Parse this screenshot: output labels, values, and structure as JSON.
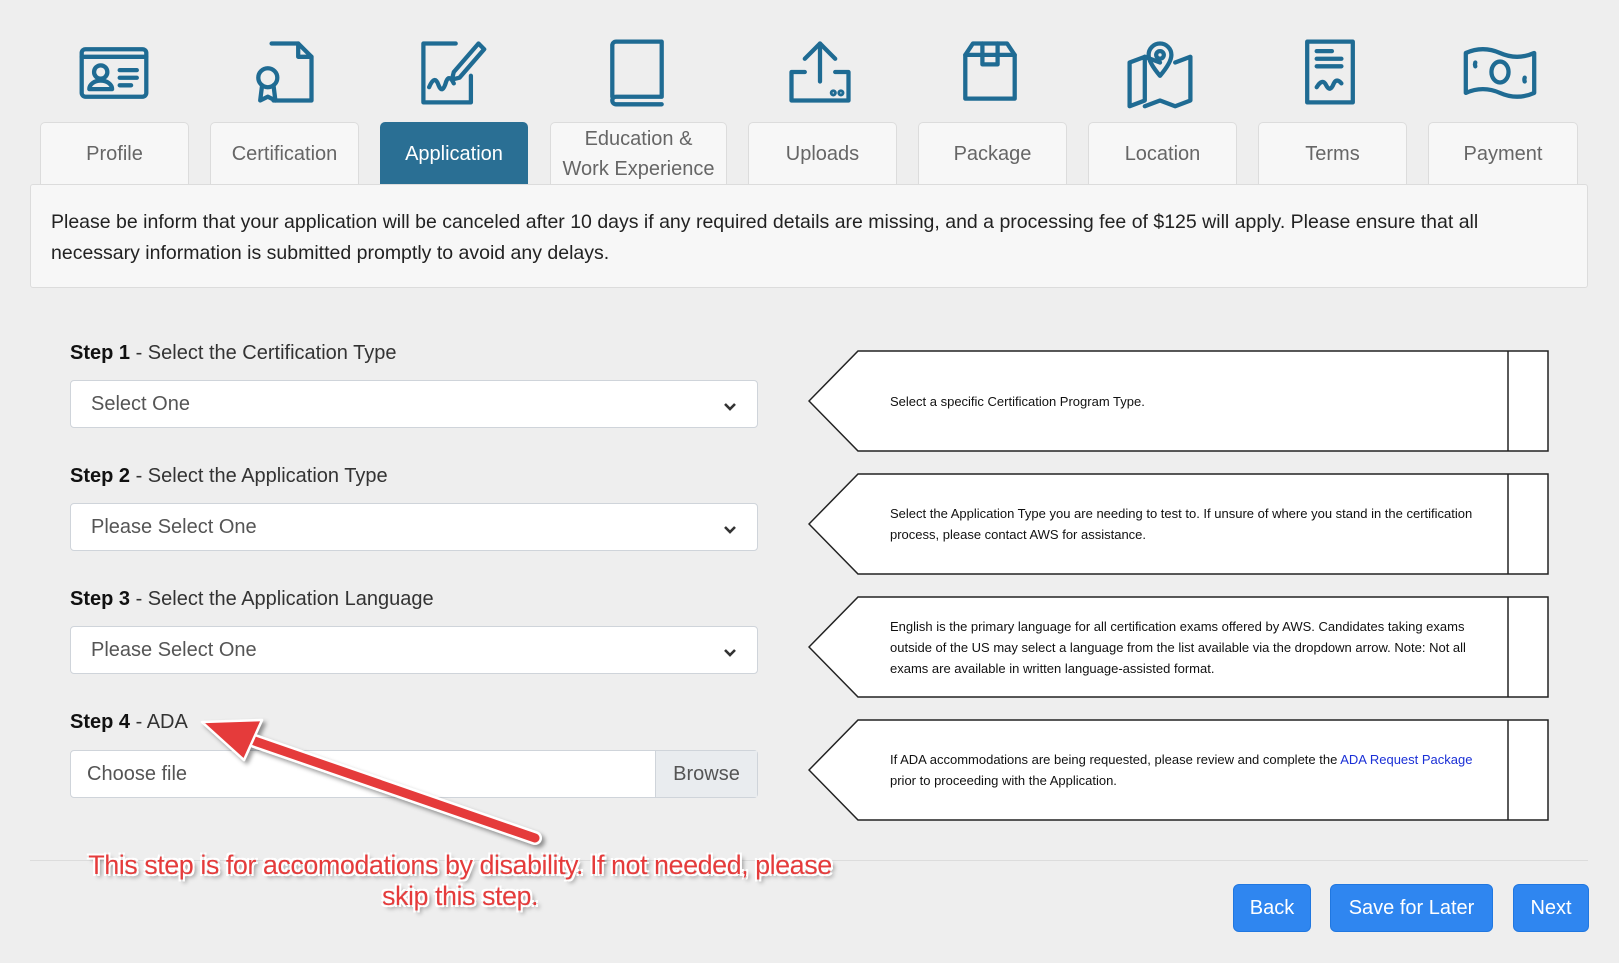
{
  "tabs": [
    {
      "label": "Profile",
      "icon": "id-card-icon"
    },
    {
      "label": "Certification",
      "icon": "certificate-icon"
    },
    {
      "label": "Application",
      "icon": "signature-icon",
      "active": true
    },
    {
      "label": "Education & Work Experience",
      "icon": "book-icon"
    },
    {
      "label": "Uploads",
      "icon": "upload-icon"
    },
    {
      "label": "Package",
      "icon": "package-icon"
    },
    {
      "label": "Location",
      "icon": "map-icon"
    },
    {
      "label": "Terms",
      "icon": "document-icon"
    },
    {
      "label": "Payment",
      "icon": "money-icon"
    }
  ],
  "notice": "Please be inform that your application will be canceled after 10 days if any required details are missing, and a processing fee of $125 will apply. Please ensure that all necessary information is submitted promptly to avoid any delays.",
  "steps": [
    {
      "num": "Step 1",
      "label": " - Select the Certification Type",
      "value": "Select One",
      "help": "Select a specific Certification Program Type."
    },
    {
      "num": "Step 2",
      "label": " - Select the Application Type",
      "value": "Please Select One",
      "help": "Select the Application Type you are needing to test to. If unsure of where you stand in the certification process, please contact AWS for assistance."
    },
    {
      "num": "Step 3",
      "label": " - Select the Application Language",
      "value": "Please Select One",
      "help": "English is the primary language for all certification exams offered by AWS. Candidates taking exams outside of the US may select a language from the list available via the dropdown arrow. Note: Not all exams are available in written language-assisted format."
    },
    {
      "num": "Step 4",
      "label": " - ADA",
      "file_placeholder": "Choose file",
      "browse": "Browse",
      "help_pre": "If ADA accommodations are being requested, please review and complete the ",
      "help_link": "ADA Request Package",
      "help_post": " prior to proceeding with the Application."
    }
  ],
  "buttons": {
    "back": "Back",
    "save": "Save for Later",
    "next": "Next"
  },
  "annotation": {
    "line1": "This step is for accomodations by disability. If not needed, please",
    "line2": "skip this step.",
    "color": "#e53b3b"
  },
  "colors": {
    "primary_tab": "#2a6f94",
    "button": "#2f86f0",
    "icon": "#1f6b93"
  }
}
